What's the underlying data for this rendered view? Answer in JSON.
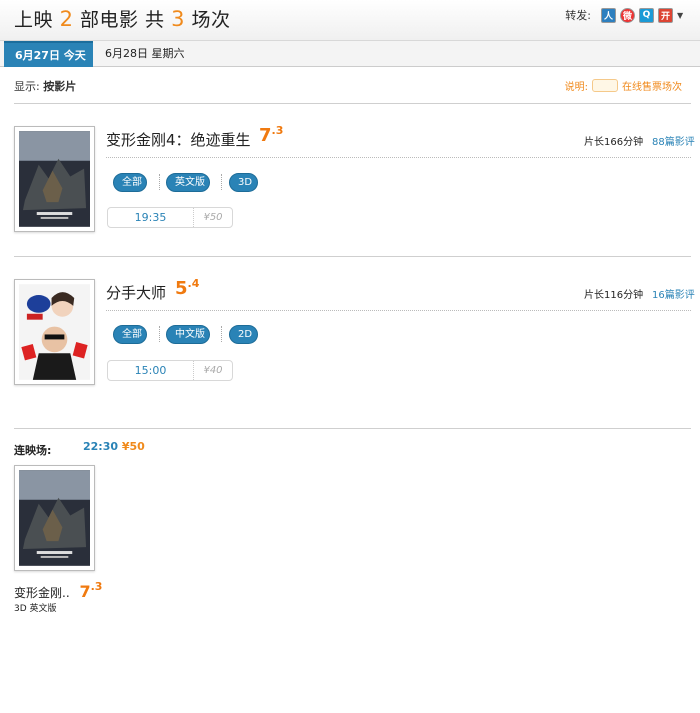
{
  "header": {
    "title_prefix": "上映",
    "movie_count": "2",
    "title_mid": "部电影 共",
    "session_count": "3",
    "title_suffix": "场次",
    "share_label": "转发:",
    "share_icons": [
      "renren-icon",
      "weibo-icon",
      "qzone-icon",
      "kaixin-icon"
    ]
  },
  "tabs": [
    {
      "label": "6月27日  今天",
      "active": true
    },
    {
      "label": "6月28日  星期六",
      "active": false
    }
  ],
  "display": {
    "label": "显示:",
    "value": "按影片"
  },
  "legend": {
    "prefix": "说明:",
    "suffix": "在线售票场次"
  },
  "movies": [
    {
      "title": "变形金刚4：绝迹重生",
      "score_int": "7",
      "score_dec": ".3",
      "runtime": "片长166分钟",
      "reviews": "88篇影评",
      "filters": [
        "全部",
        "英文版",
        "3D"
      ],
      "showtimes": [
        {
          "time": "19:35",
          "price": "¥50"
        }
      ]
    },
    {
      "title": "分手大师",
      "score_int": "5",
      "score_dec": ".4",
      "runtime": "片长116分钟",
      "reviews": "16篇影评",
      "filters": [
        "全部",
        "中文版",
        "2D"
      ],
      "showtimes": [
        {
          "time": "15:00",
          "price": "¥40"
        }
      ]
    }
  ],
  "consecutive": {
    "label": "连映场:",
    "time": "22:30",
    "price": "¥50",
    "title": "变形金刚..",
    "score_int": "7",
    "score_dec": ".3",
    "meta": "3D  英文版"
  },
  "colors": {
    "accent_blue": "#2a83b6",
    "accent_orange": "#f08a1c"
  }
}
